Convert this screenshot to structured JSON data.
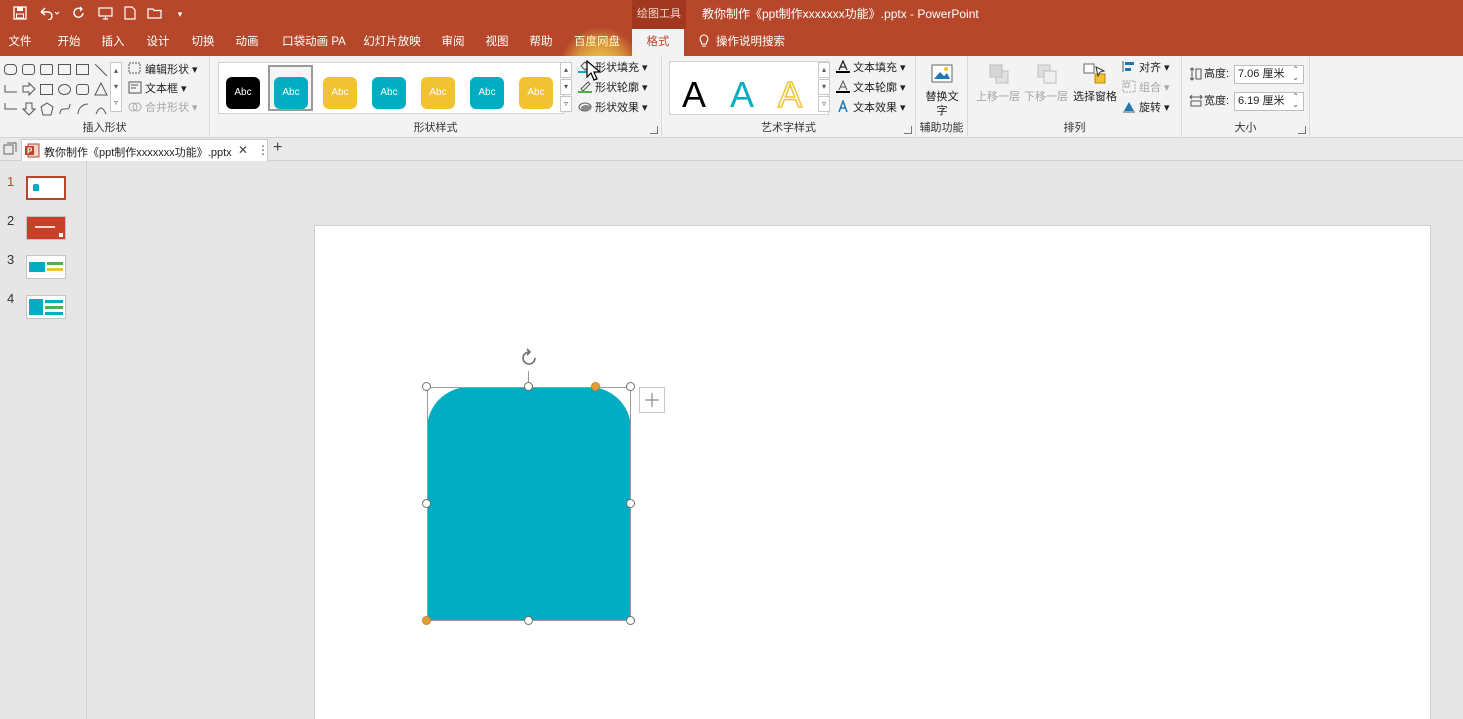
{
  "app": {
    "window_title": "教你制作《ppt制作xxxxxxx功能》.pptx  -  PowerPoint",
    "context_tab_group": "绘图工具",
    "accent_color": "#b7472a"
  },
  "qat": {
    "save_icon": "save-icon",
    "undo_icon": "undo-icon",
    "redo_icon": "redo-icon",
    "more": "▾"
  },
  "tabs": [
    {
      "label": "文件"
    },
    {
      "label": "开始"
    },
    {
      "label": "插入"
    },
    {
      "label": "设计"
    },
    {
      "label": "切换"
    },
    {
      "label": "动画"
    },
    {
      "label": "口袋动画 PA"
    },
    {
      "label": "幻灯片放映"
    },
    {
      "label": "审阅"
    },
    {
      "label": "视图"
    },
    {
      "label": "帮助"
    },
    {
      "label": "百度网盘"
    },
    {
      "label": "格式",
      "active": true
    },
    {
      "label": "操作说明搜索"
    }
  ],
  "ribbon": {
    "insert_shapes": {
      "label": "插入形状",
      "edit_shape": "编辑形状",
      "text_box": "文本框",
      "merge_shapes": "合并形状"
    },
    "shape_styles": {
      "label": "形状样式",
      "swatch_text": "Abc",
      "fill": "形状填充",
      "outline": "形状轮廓",
      "effects": "形状效果",
      "swatches": [
        {
          "bg": "#000000",
          "fg": "#ffffff"
        },
        {
          "bg": "#00adc2",
          "fg": "#ffffff",
          "selected": true
        },
        {
          "bg": "#f1c232",
          "fg": "#ffffff"
        },
        {
          "bg": "#00adc2",
          "fg": "#ffffff"
        },
        {
          "bg": "#f1c232",
          "fg": "#ffffff"
        },
        {
          "bg": "#00adc2",
          "fg": "#ffffff"
        },
        {
          "bg": "#f1c232",
          "fg": "#ffffff"
        }
      ]
    },
    "wordart": {
      "label": "艺术字样式",
      "letter": "A",
      "text_fill": "文本填充",
      "text_outline": "文本轮廓",
      "text_effects": "文本效果"
    },
    "accessibility": {
      "label": "辅助功能",
      "alt_text": "替换文字"
    },
    "arrange": {
      "label": "排列",
      "bring_forward": "上移一层",
      "send_backward": "下移一层",
      "selection_pane": "选择窗格",
      "align": "对齐",
      "group": "组合",
      "rotate": "旋转"
    },
    "size": {
      "label": "大小",
      "height_label": "高度:",
      "height_value": "7.06 厘米",
      "width_label": "宽度:",
      "width_value": "6.19 厘米"
    }
  },
  "document_tab": {
    "name": "教你制作《ppt制作xxxxxxx功能》.pptx",
    "close": "✕",
    "menu": "⋮",
    "new": "+"
  },
  "slides": [
    {
      "number": "1",
      "selected": true
    },
    {
      "number": "2"
    },
    {
      "number": "3"
    },
    {
      "number": "4"
    }
  ],
  "shape": {
    "fill_color": "#00adc2"
  }
}
